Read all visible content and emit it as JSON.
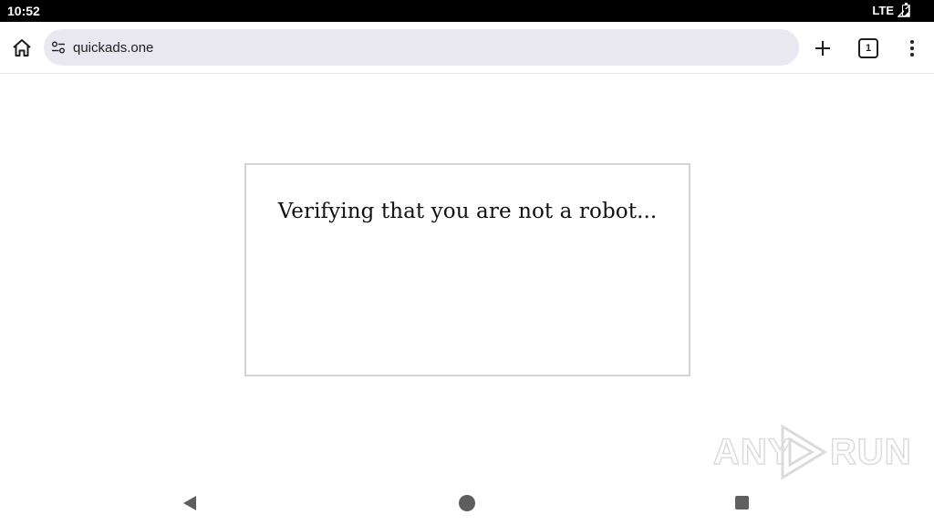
{
  "status_bar": {
    "time": "10:52",
    "network": "LTE",
    "icons": [
      "signal-icon",
      "battery-icon"
    ]
  },
  "browser": {
    "url": "quickads.one",
    "tab_count": "1",
    "icons": [
      "home-icon",
      "site-settings-icon",
      "plus-icon",
      "tabs-icon",
      "more-vert-icon"
    ]
  },
  "page": {
    "message": "Verifying that you are not a robot..."
  },
  "watermark": {
    "text_left": "ANY",
    "text_right": "RUN"
  },
  "nav_bar": {
    "icons": [
      "back-icon",
      "home-circle-icon",
      "recents-icon"
    ]
  },
  "colors": {
    "status_bar_bg": "#000000",
    "url_bar_bg": "#e9e8f0",
    "box_border": "#d3d3d3",
    "nav_icon": "#5f5f5f"
  }
}
